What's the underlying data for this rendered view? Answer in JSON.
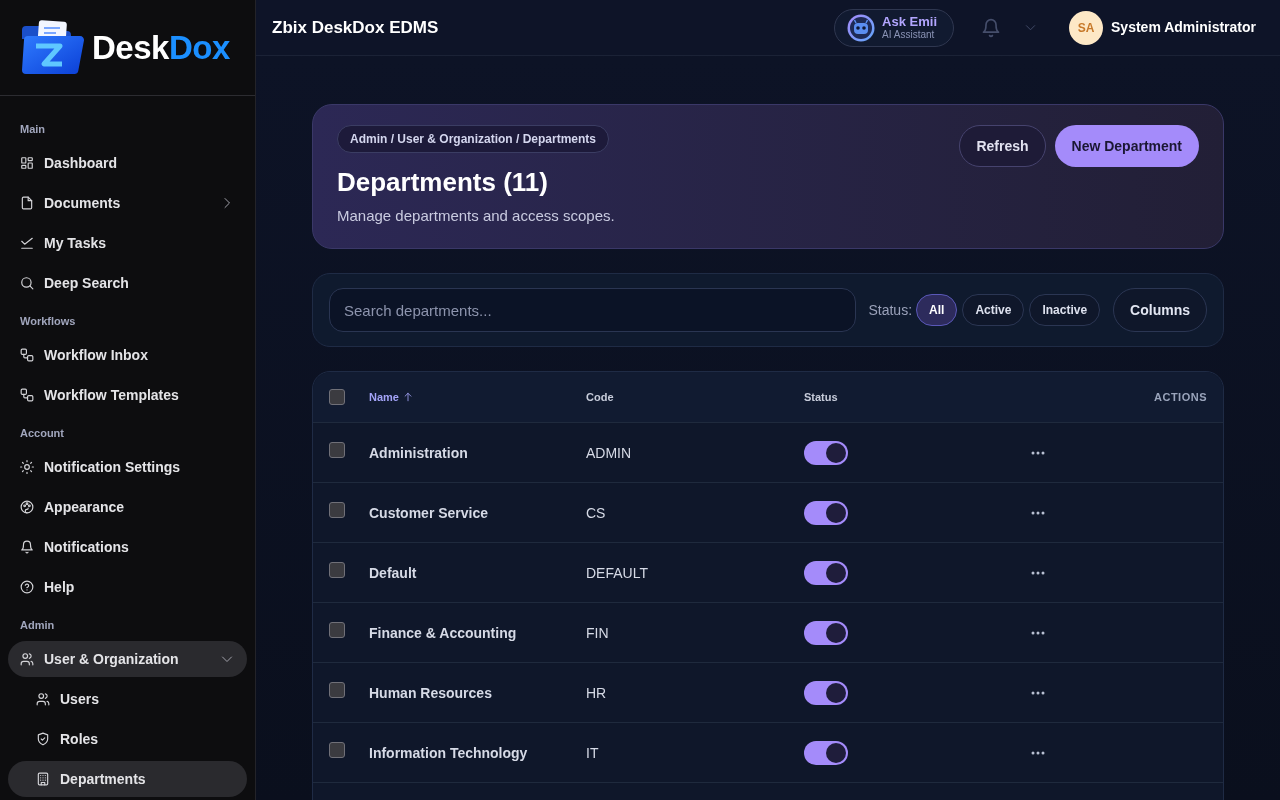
{
  "sidebar": {
    "logo": {
      "parts": [
        {
          "text": "Desk",
          "accent": false
        },
        {
          "text": "Dox",
          "accent": true
        }
      ]
    },
    "sections": [
      {
        "title": "Main",
        "items": [
          {
            "label": "Dashboard",
            "selected": false
          },
          {
            "label": "Documents",
            "selected": false,
            "expanded": false
          },
          {
            "label": "My Tasks",
            "selected": false
          },
          {
            "label": "Deep Search",
            "selected": false
          }
        ]
      },
      {
        "title": "Workflows",
        "items": [
          {
            "label": "Workflow Inbox",
            "selected": false
          },
          {
            "label": "Workflow Templates",
            "selected": false
          }
        ]
      },
      {
        "title": "Account",
        "items": [
          {
            "label": "Notification Settings",
            "selected": false
          },
          {
            "label": "Appearance",
            "selected": false
          },
          {
            "label": "Notifications",
            "selected": false
          },
          {
            "label": "Help",
            "selected": false
          }
        ]
      },
      {
        "title": "Admin",
        "items": [
          {
            "label": "User & Organization",
            "selected": true,
            "expanded": true,
            "children": [
              {
                "label": "Users",
                "selected": false
              },
              {
                "label": "Roles",
                "selected": false
              },
              {
                "label": "Departments",
                "selected": true
              }
            ]
          }
        ]
      }
    ]
  },
  "header": {
    "title": "Zbix DeskDox EDMS",
    "assistant": {
      "name": "Ask Emii",
      "subtitle": "AI Assistant"
    },
    "user": {
      "initials": "SA",
      "name": "System Administrator"
    }
  },
  "page_header": {
    "breadcrumb": "Admin / User & Organization / Departments",
    "title": "Departments (11)",
    "subtitle": "Manage departments and access scopes.",
    "buttons": [
      {
        "label": "Refresh",
        "kind": "secondary"
      },
      {
        "label": "New Department",
        "kind": "primary"
      }
    ]
  },
  "filters": {
    "search": {
      "placeholder": "Search departments..."
    },
    "status_label": "Status:",
    "status_options": [
      {
        "label": "All",
        "selected": true
      },
      {
        "label": "Active",
        "selected": false
      },
      {
        "label": "Inactive",
        "selected": false
      }
    ],
    "columns_button": "Columns"
  },
  "table": {
    "select_all": {
      "checked": false
    },
    "columns": [
      {
        "label": "Name",
        "sorted": true
      },
      {
        "label": "Code",
        "sorted": false
      },
      {
        "label": "Status",
        "sorted": false
      },
      {
        "label": "ACTIONS",
        "sorted": false
      }
    ],
    "rows": [
      {
        "checked": false,
        "name": "Administration",
        "code": "ADMIN",
        "active": true
      },
      {
        "checked": false,
        "name": "Customer Service",
        "code": "CS",
        "active": true
      },
      {
        "checked": false,
        "name": "Default",
        "code": "DEFAULT",
        "active": true
      },
      {
        "checked": false,
        "name": "Finance & Accounting",
        "code": "FIN",
        "active": true
      },
      {
        "checked": false,
        "name": "Human Resources",
        "code": "HR",
        "active": true
      },
      {
        "checked": false,
        "name": "Information Technology",
        "code": "IT",
        "active": true
      }
    ]
  }
}
